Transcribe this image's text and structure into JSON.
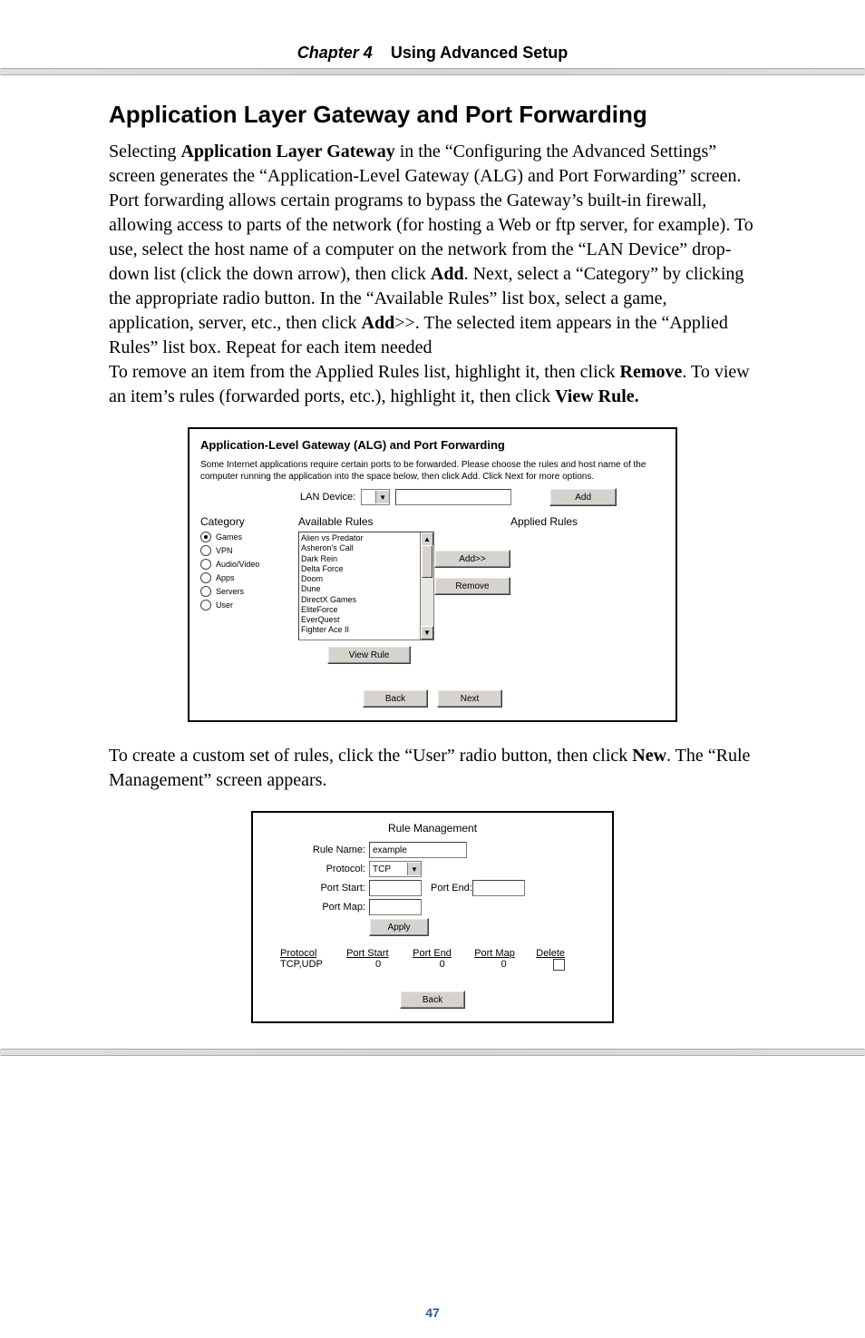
{
  "header": {
    "chapter": "Chapter 4",
    "title": "Using Advanced Setup"
  },
  "section_title": "Application Layer Gateway and Port Forwarding",
  "para1_parts": {
    "p1": "Selecting ",
    "b1": "Application Layer Gateway",
    "p2": " in the “Configuring the Advanced Settings” screen generates the “Application-Level Gateway (",
    "sc1": "ALG",
    "p3": ") and Port Forwarding” screen. Port forwarding allows certain programs to bypass the Gateway’s built-in firewall, allowing access to parts of the network (for hosting a Web or ftp server, for example). To use, select the host name of a computer on the network from the “",
    "sc2": "LAN",
    "p4": " Device” drop-down list (click the down arrow), then click ",
    "b2": "Add",
    "p5": ". Next, select a “Category” by clicking the appropriate radio button. In the “Available Rules” list box, select a game, application, server, etc., then click ",
    "b3": "Add",
    "p6": ">>. The selected item appears in the “Applied Rules” list box. Repeat for each item needed",
    "p7": "To remove an item from the Applied Rules list, highlight it, then click ",
    "b4": "Remove",
    "p8": ". To view an item’s rules (forwarded ports, etc.), highlight it, then click ",
    "b5": "View Rule."
  },
  "shot1": {
    "title": "Application-Level Gateway (ALG) and Port Forwarding",
    "intro": "Some Internet applications require certain ports to be forwarded. Please choose the rules and host name of the computer running the application into the space below, then click Add. Click Next for more options.",
    "lan_label": "LAN Device:",
    "add_btn": "Add",
    "headers": {
      "category": "Category",
      "available": "Available Rules",
      "applied": "Applied Rules"
    },
    "categories": [
      "Games",
      "VPN",
      "Audio/Video",
      "Apps",
      "Servers",
      "User"
    ],
    "rules": [
      "Alien vs Predator",
      "Asheron's Call",
      "Dark Rein",
      "Delta Force",
      "Doom",
      "Dune",
      "DirectX Games",
      "EliteForce",
      "EverQuest",
      "Fighter Ace II"
    ],
    "addrr": "Add>>",
    "remove": "Remove",
    "viewrule": "View Rule",
    "back": "Back",
    "next": "Next"
  },
  "para2_parts": {
    "p1": "To create a custom set of rules, click the “User” radio button, then click ",
    "b1": "New",
    "p2": ". The “Rule Management” screen appears."
  },
  "shot2": {
    "title": "Rule Management",
    "labels": {
      "rule_name": "Rule Name:",
      "protocol": "Protocol:",
      "port_start": "Port Start:",
      "port_end": "Port End:",
      "port_map": "Port Map:"
    },
    "values": {
      "rule_name": "example",
      "protocol": "TCP"
    },
    "apply": "Apply",
    "cols": {
      "protocol": "Protocol",
      "port_start": "Port Start",
      "port_end": "Port End",
      "port_map": "Port Map",
      "delete": "Delete"
    },
    "row": {
      "protocol": "TCP,UDP",
      "port_start": "0",
      "port_end": "0",
      "port_map": "0"
    },
    "back": "Back"
  },
  "page_number": "47"
}
